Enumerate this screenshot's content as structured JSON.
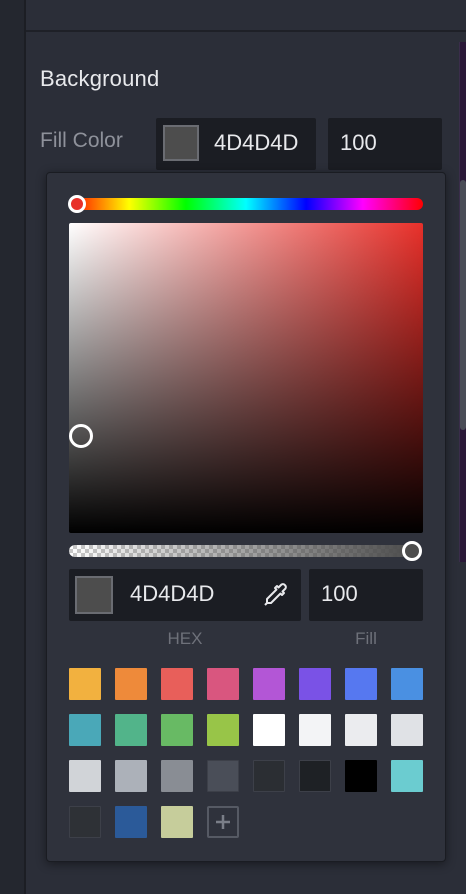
{
  "background_section": {
    "title": "Background",
    "fill_label": "Fill Color",
    "fill_hex": "4D4D4D",
    "fill_opacity": "100",
    "current_color": "#4D4D4D"
  },
  "color_picker": {
    "hue_color": "#e8302a",
    "hue_position": 0,
    "saturation": 0.04,
    "value": 0.3,
    "alpha": 1.0,
    "hex_value": "4D4D4D",
    "alpha_value": "100",
    "hex_label": "HEX",
    "fill_label": "Fill",
    "eyedropper_icon": "eyedropper-icon",
    "add_swatch_icon": "plus-icon",
    "swatches": [
      "#f2b13f",
      "#ee8a3a",
      "#e85f5a",
      "#d9567f",
      "#b356d6",
      "#7a52e6",
      "#5678f0",
      "#4a90e2",
      "#4aa8b8",
      "#52b48a",
      "#68ba64",
      "#98c548",
      "#ffffff",
      "#f3f4f6",
      "#ebecef",
      "#e0e2e6",
      "#d1d4d8",
      "#acb1b9",
      "#898d94",
      "#4a4e58",
      "#2b2e33",
      "#1e2125",
      "#000000",
      "#6bccd0",
      "#2e3136",
      "#2b5a99",
      "#c6cd9b"
    ]
  }
}
